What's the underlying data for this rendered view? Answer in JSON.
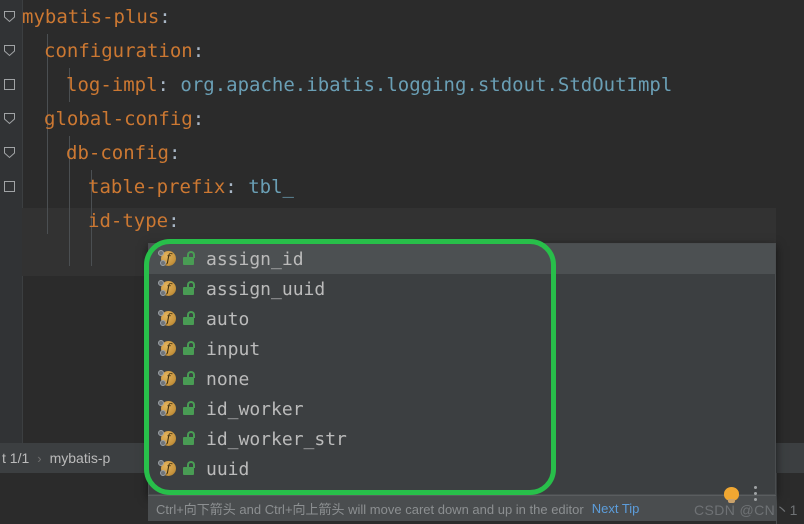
{
  "app": {
    "theme": "darcula",
    "editor_bg": "#2b2b2b",
    "popup_bg": "#3c3f41",
    "selected_bg": "#4c5052",
    "accent_link": "#5c9ddb",
    "annotation_color": "#28bf4a",
    "keyword_color": "#cc7832",
    "value_color": "#6a9fb5"
  },
  "editor": {
    "lines": [
      {
        "indent": 0,
        "key": "mybatis-plus",
        "colon": ":",
        "value": ""
      },
      {
        "indent": 2,
        "key": "configuration",
        "colon": ":",
        "value": ""
      },
      {
        "indent": 4,
        "key": "log-impl",
        "colon": ":",
        "value": "org.apache.ibatis.logging.stdout.StdOutImpl"
      },
      {
        "indent": 2,
        "key": "global-config",
        "colon": ":",
        "value": ""
      },
      {
        "indent": 4,
        "key": "db-config",
        "colon": ":",
        "value": ""
      },
      {
        "indent": 6,
        "key": "table-prefix",
        "colon": ":",
        "value": "tbl_"
      },
      {
        "indent": 6,
        "key": "id-type",
        "colon": ":",
        "value": ""
      }
    ]
  },
  "completion": {
    "items": [
      {
        "label": "assign_id",
        "icon": "field-icon",
        "modifier": "lock-icon",
        "selected": true
      },
      {
        "label": "assign_uuid",
        "icon": "field-icon",
        "modifier": "lock-icon",
        "selected": false
      },
      {
        "label": "auto",
        "icon": "field-icon",
        "modifier": "lock-icon",
        "selected": false
      },
      {
        "label": "input",
        "icon": "field-icon",
        "modifier": "lock-icon",
        "selected": false
      },
      {
        "label": "none",
        "icon": "field-icon",
        "modifier": "lock-icon",
        "selected": false
      },
      {
        "label": "id_worker",
        "icon": "field-icon",
        "modifier": "lock-icon",
        "selected": false
      },
      {
        "label": "id_worker_str",
        "icon": "field-icon",
        "modifier": "lock-icon",
        "selected": false
      },
      {
        "label": "uuid",
        "icon": "field-icon",
        "modifier": "lock-icon",
        "selected": false
      }
    ]
  },
  "tip": {
    "text": "Ctrl+向下箭头 and Ctrl+向上箭头 will move caret down and up in the editor",
    "link": "Next Tip"
  },
  "breadcrumb": {
    "count": "t 1/1",
    "separator": "›",
    "item": "mybatis-p"
  },
  "status": {
    "watermark": "CSDN @CN丶1",
    "bulb_icon": "lightbulb-icon",
    "menu_icon": "kebab-menu-icon"
  }
}
